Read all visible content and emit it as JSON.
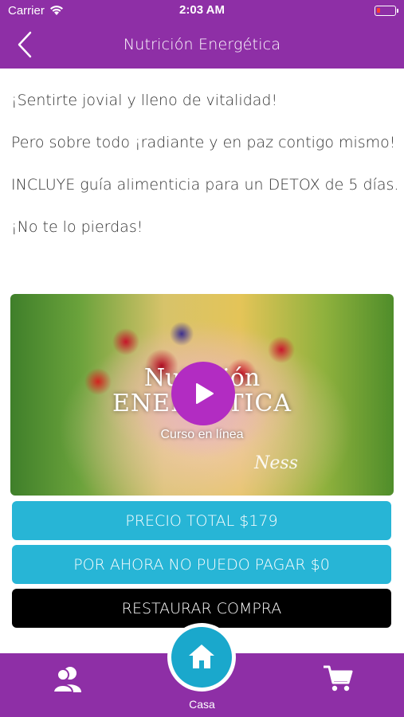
{
  "status_bar": {
    "carrier": "Carrier",
    "time": "2:03 AM",
    "battery_color": "#ff3b30"
  },
  "nav": {
    "title": "Nutrición Energética",
    "back_icon": "chevron-left-icon",
    "bar_color": "#8e2fa6"
  },
  "description": {
    "lines": [
      "¡Sentirte jovial y lleno de vitalidad!",
      "Pero sobre todo ¡radiante y en paz contigo mismo!",
      "INCLUYE guía alimenticia para un DETOX de 5 días.",
      "¡No te lo pierdas!"
    ]
  },
  "video": {
    "title_line1": "Nutrición",
    "title_line2": "ENERGÉTICA",
    "subtitle": "Curso en línea",
    "signature": "Ness",
    "play_icon": "play-icon",
    "play_color": "#b22cc2"
  },
  "actions": {
    "price_label": "PRECIO TOTAL $179",
    "free_label": "POR AHORA NO PUEDO PAGAR $0",
    "restore_label": "RESTAURAR COMPRA",
    "primary_color": "#27b5d6",
    "restore_color": "#000000"
  },
  "tabbar": {
    "items": [
      {
        "icon": "profile-icon",
        "label": ""
      },
      {
        "icon": "home-icon",
        "label": "Casa"
      },
      {
        "icon": "cart-icon",
        "label": ""
      }
    ],
    "home_color": "#1aa8cc"
  }
}
